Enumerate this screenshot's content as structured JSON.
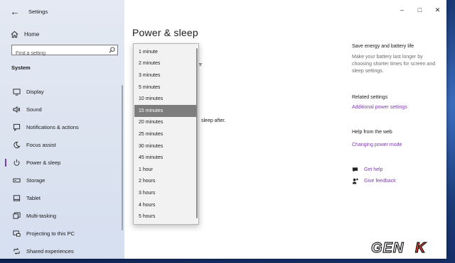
{
  "window": {
    "title": "Settings"
  },
  "sidebar": {
    "home_label": "Home",
    "search_placeholder": "Find a setting",
    "section_heading": "System",
    "items": [
      {
        "label": "Display",
        "icon": "monitor-icon"
      },
      {
        "label": "Sound",
        "icon": "speaker-icon"
      },
      {
        "label": "Notifications & actions",
        "icon": "notification-icon"
      },
      {
        "label": "Focus assist",
        "icon": "moon-icon"
      },
      {
        "label": "Power & sleep",
        "icon": "power-icon",
        "active": true
      },
      {
        "label": "Storage",
        "icon": "drive-icon"
      },
      {
        "label": "Tablet",
        "icon": "tablet-icon"
      },
      {
        "label": "Multi-tasking",
        "icon": "multitask-icon"
      },
      {
        "label": "Projecting to this PC",
        "icon": "projector-icon"
      },
      {
        "label": "Shared experiences",
        "icon": "shared-icon"
      }
    ]
  },
  "main": {
    "page_title": "Power & sleep",
    "peek_text_1": "er",
    "peek_text_2": "sleep after."
  },
  "dropdown": {
    "selected": "15 minutes",
    "options": [
      "1 minute",
      "2 minutes",
      "3 minutes",
      "5 minutes",
      "10 minutes",
      "15 minutes",
      "20 minutes",
      "25 minutes",
      "30 minutes",
      "45 minutes",
      "1 hour",
      "2 hours",
      "3 hours",
      "4 hours",
      "5 hours"
    ]
  },
  "right_panel": {
    "save_heading": "Save energy and battery life",
    "save_text": "Make your battery last longer by choosing shorter times for screen and sleep settings.",
    "related_heading": "Related settings",
    "related_link": "Additional power settings",
    "help_heading": "Help from the web",
    "help_link": "Changing power mode",
    "get_help": "Get help",
    "give_feedback": "Give feedback"
  },
  "watermark": {
    "text": "GENK"
  },
  "colors": {
    "accent": "#7a3ea8",
    "selected_bg": "#7d7d7d"
  }
}
